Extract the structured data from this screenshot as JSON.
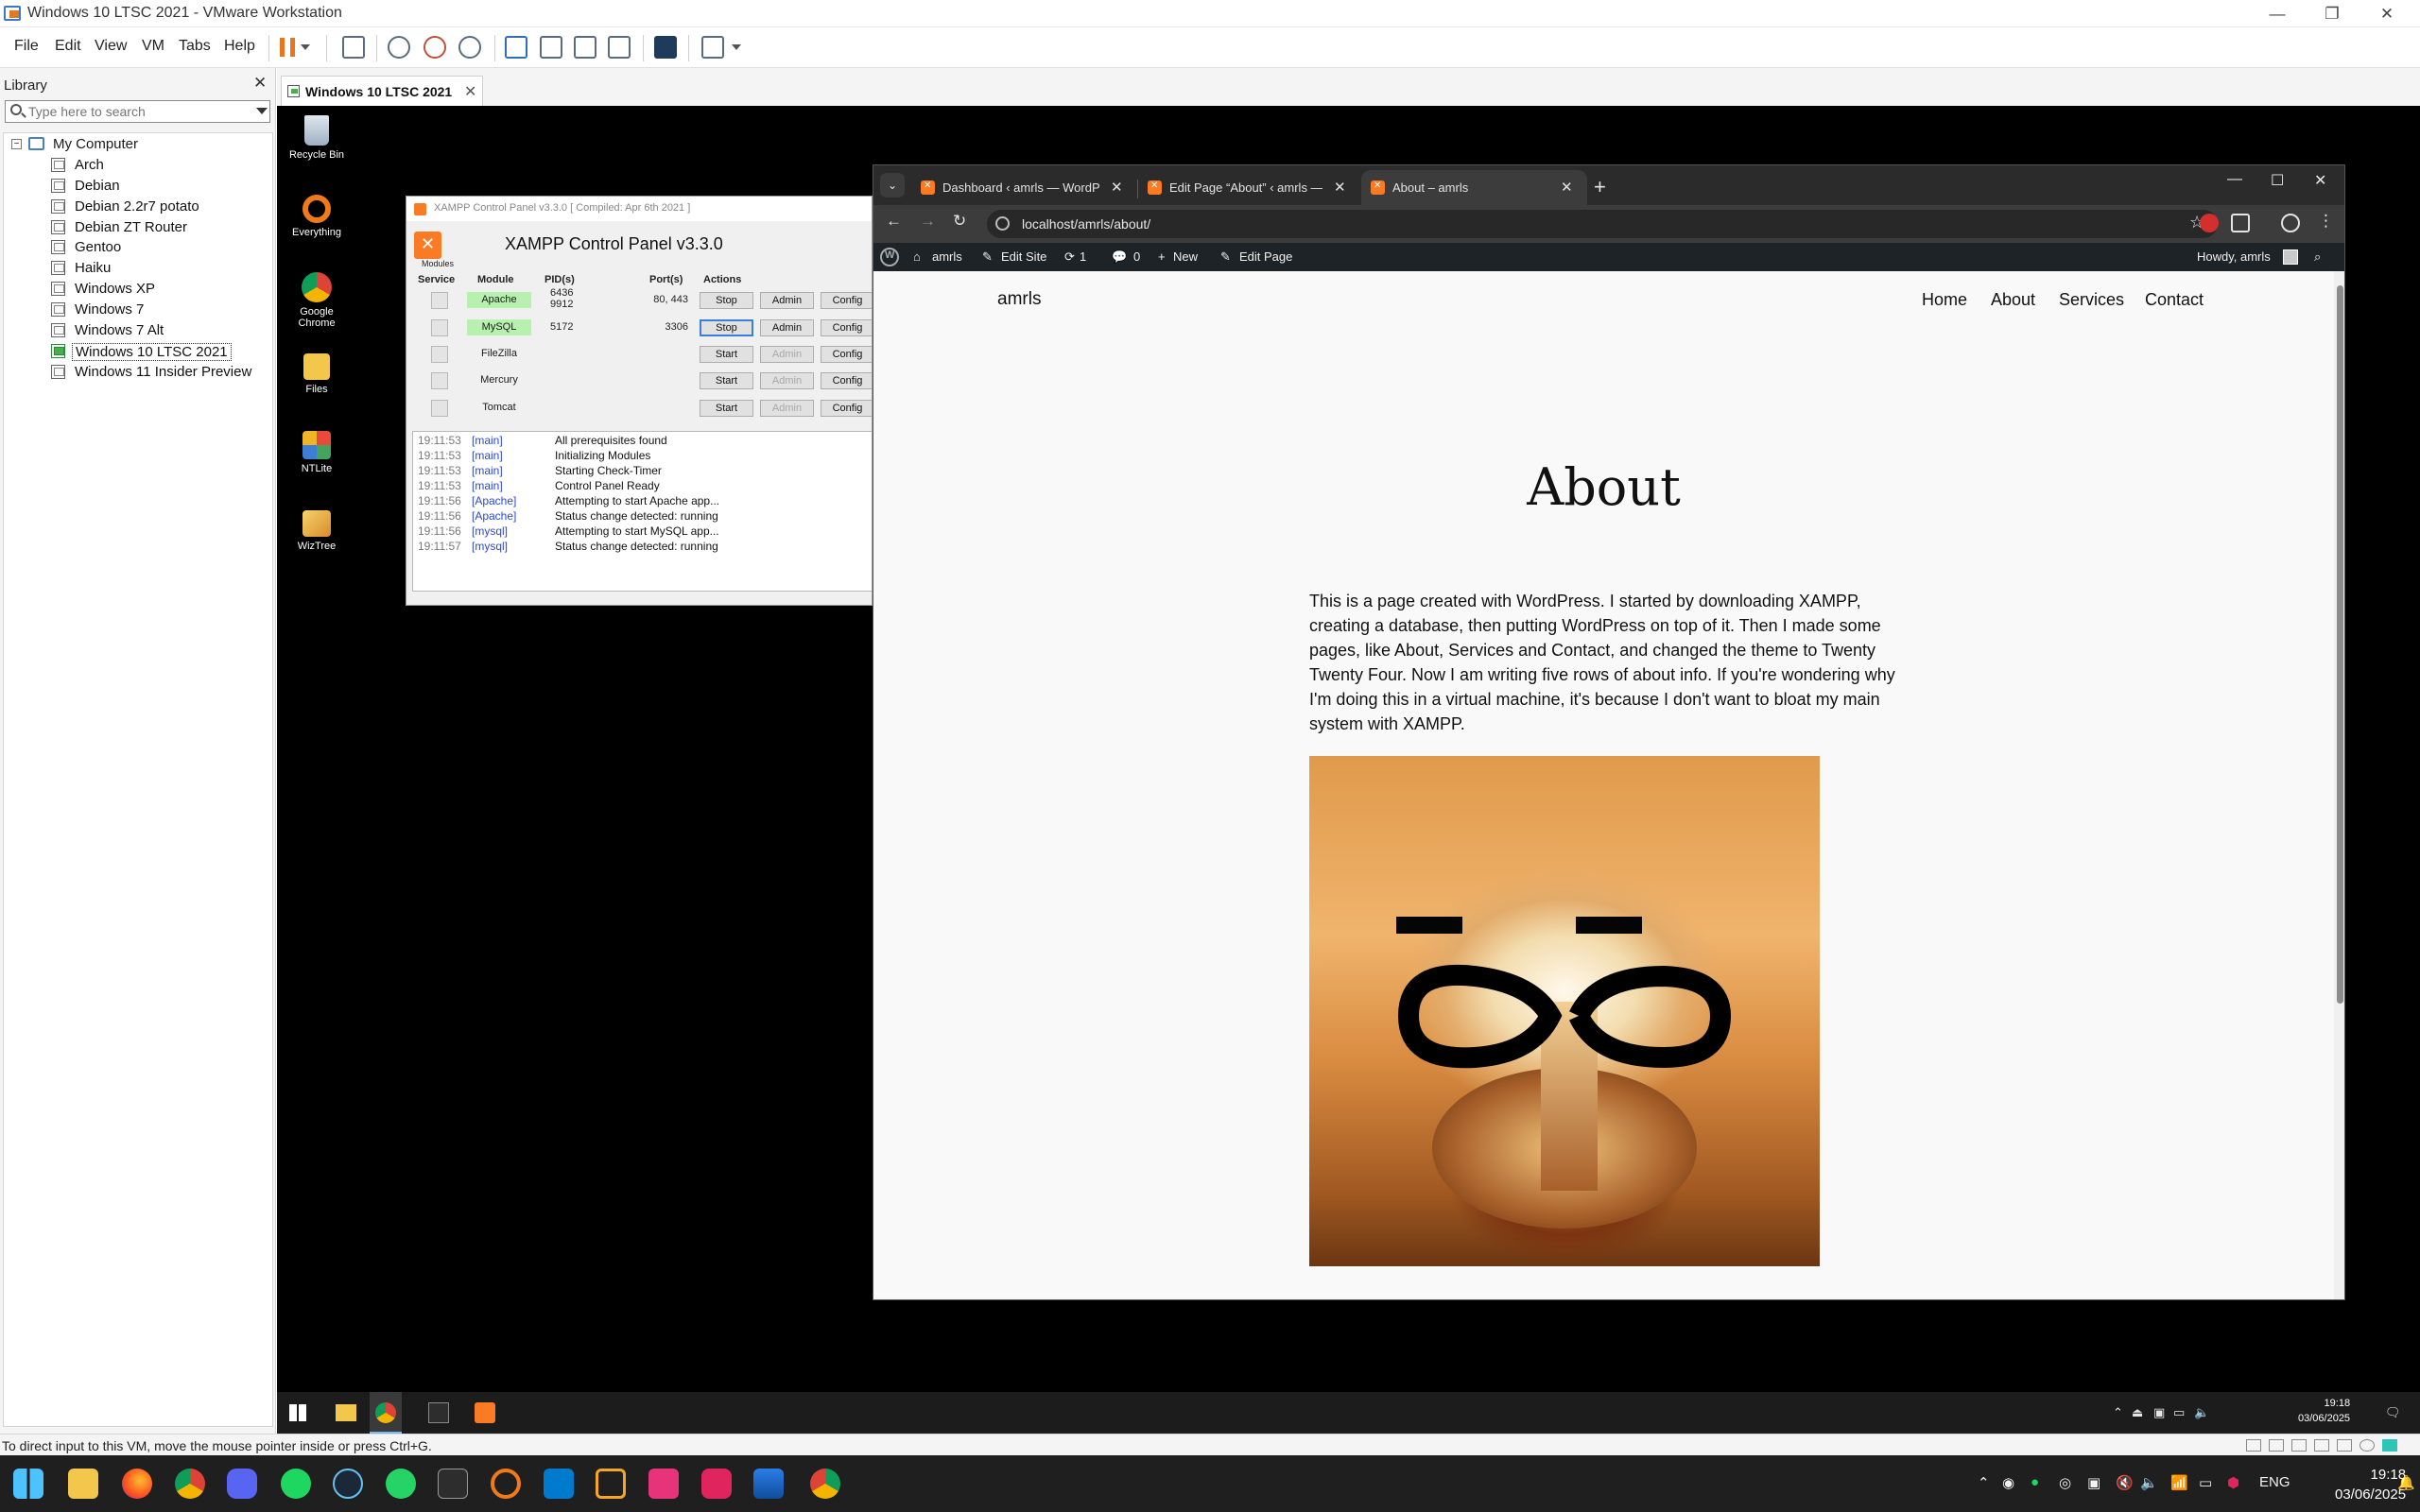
{
  "vmware": {
    "title": "Windows 10 LTSC 2021 - VMware Workstation",
    "menu": [
      "File",
      "Edit",
      "View",
      "VM",
      "Tabs",
      "Help"
    ],
    "library_title": "Library",
    "search_placeholder": "Type here to search",
    "tree_root": "My Computer",
    "vms": [
      "Arch",
      "Debian",
      "Debian 2.2r7 potato",
      "Debian ZT Router",
      "Gentoo",
      "Haiku",
      "Windows XP",
      "Windows 7",
      "Windows 7 Alt",
      "Windows 10 LTSC 2021",
      "Windows 11 Insider Preview"
    ],
    "selected_vm": "Windows 10 LTSC 2021",
    "tab_label": "Windows 10 LTSC 2021",
    "status_text": "To direct input to this VM, move the mouse pointer inside or press Ctrl+G."
  },
  "desktop_icons": [
    {
      "label": "Recycle Bin",
      "icon": "recycle-bin-icon"
    },
    {
      "label": "Everything",
      "icon": "everything-icon"
    },
    {
      "label": "Google Chrome",
      "icon": "chrome-icon"
    },
    {
      "label": "Files",
      "icon": "folder-icon"
    },
    {
      "label": "NTLite",
      "icon": "ntlite-icon"
    },
    {
      "label": "WizTree",
      "icon": "wiztree-icon"
    }
  ],
  "xampp": {
    "title": "XAMPP Control Panel v3.3.0   [ Compiled: Apr 6th 2021 ]",
    "heading": "XAMPP Control Panel v3.3.0",
    "modules_label": "Modules",
    "headers": {
      "service": "Service",
      "module": "Module",
      "pids": "PID(s)",
      "ports": "Port(s)",
      "actions": "Actions"
    },
    "rows": [
      {
        "module": "Apache",
        "pid1": "6436",
        "pid2": "9912",
        "ports": "80, 443",
        "action": "Stop",
        "admin": "Admin",
        "config": "Config"
      },
      {
        "module": "MySQL",
        "pid1": "5172",
        "pid2": "",
        "ports": "3306",
        "action": "Stop",
        "admin": "Admin",
        "config": "Config"
      },
      {
        "module": "FileZilla",
        "pid1": "",
        "pid2": "",
        "ports": "",
        "action": "Start",
        "admin": "Admin",
        "config": "Config"
      },
      {
        "module": "Mercury",
        "pid1": "",
        "pid2": "",
        "ports": "",
        "action": "Start",
        "admin": "Admin",
        "config": "Config"
      },
      {
        "module": "Tomcat",
        "pid1": "",
        "pid2": "",
        "ports": "",
        "action": "Start",
        "admin": "Admin",
        "config": "Config"
      }
    ],
    "log": [
      {
        "ts": "19:11:53",
        "src": "[main]",
        "msg": "All prerequisites found"
      },
      {
        "ts": "19:11:53",
        "src": "[main]",
        "msg": "Initializing Modules"
      },
      {
        "ts": "19:11:53",
        "src": "[main]",
        "msg": "Starting Check-Timer"
      },
      {
        "ts": "19:11:53",
        "src": "[main]",
        "msg": "Control Panel Ready"
      },
      {
        "ts": "19:11:56",
        "src": "[Apache]",
        "msg": "Attempting to start Apache app..."
      },
      {
        "ts": "19:11:56",
        "src": "[Apache]",
        "msg": "Status change detected: running"
      },
      {
        "ts": "19:11:56",
        "src": "[mysql]",
        "msg": "Attempting to start MySQL app..."
      },
      {
        "ts": "19:11:57",
        "src": "[mysql]",
        "msg": "Status change detected: running"
      }
    ]
  },
  "chrome": {
    "tabs": [
      {
        "title": "Dashboard ‹ amrls — WordPress"
      },
      {
        "title": "Edit Page “About” ‹ amrls — WordPress"
      },
      {
        "title": "About – amrls"
      }
    ],
    "url": "localhost/amrls/about/",
    "adminbar": {
      "site": "amrls",
      "edit_site": "Edit Site",
      "updates": "1",
      "comments": "0",
      "new": "New",
      "edit_page": "Edit Page",
      "howdy": "Howdy, amrls"
    }
  },
  "page": {
    "site_title": "amrls",
    "nav": [
      "Home",
      "About",
      "Services",
      "Contact"
    ],
    "heading": "About",
    "body": "This is a page created with WordPress. I started by downloading XAMPP, creating a database, then putting WordPress on top of it. Then I made some pages, like About, Services and Contact, and changed the theme to Twenty Twenty Four. Now I am writing five rows of about info. If you're wondering why I'm doing this in a virtual machine, it's because I don't want to bloat my main system with XAMPP."
  },
  "guest_clock": {
    "time": "19:18",
    "date": "03/06/2025"
  },
  "host_clock": {
    "time": "19:18",
    "date": "03/06/2025",
    "lang": "ENG"
  },
  "colors": {
    "xampp_orange": "#fb7a24",
    "running_green": "#b8f0b0",
    "wp_adminbar": "#1d2327"
  }
}
